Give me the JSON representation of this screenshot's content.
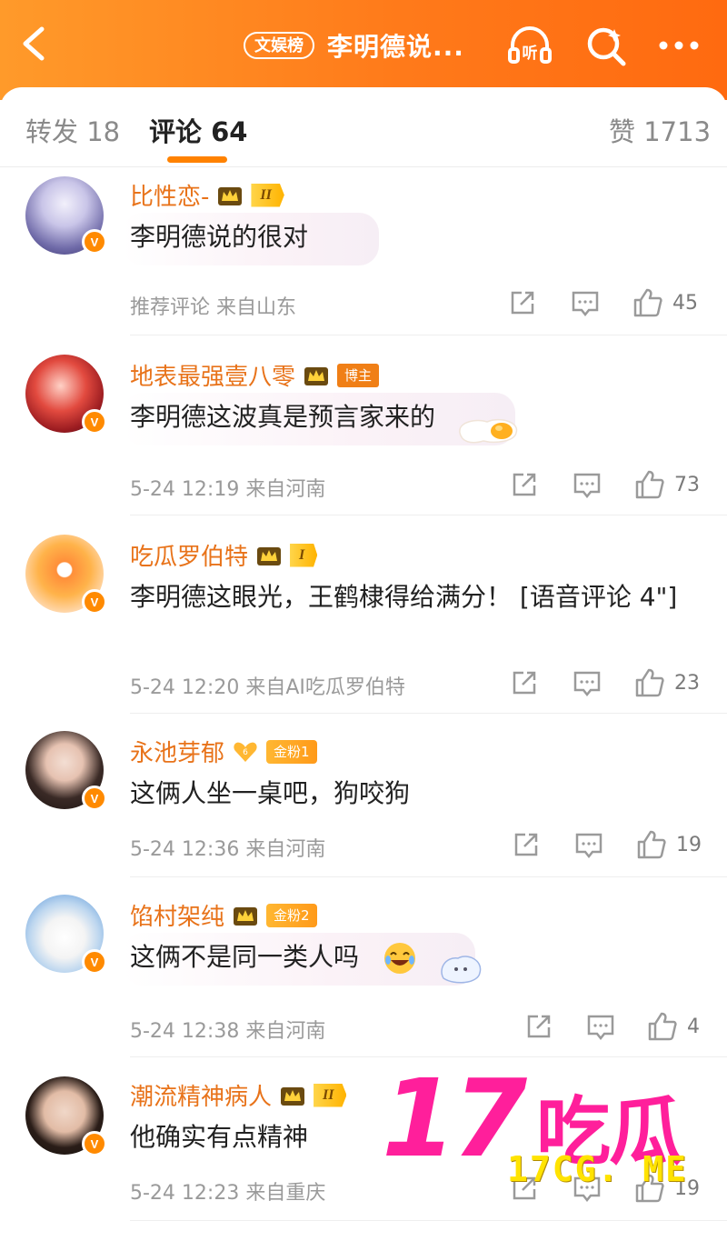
{
  "header": {
    "tag": "文娱榜",
    "title": "李明德说...",
    "listen_icon_text": "听"
  },
  "tabs": {
    "repost": "转发 18",
    "comments": "评论 64",
    "likes": "赞 1713"
  },
  "comments": [
    {
      "name": "比性恋-",
      "badge": "II",
      "text": "李明德说的很对",
      "meta": "推荐评论  来自山东",
      "likes": "45"
    },
    {
      "name": "地表最强壹八零",
      "badge": "博主",
      "text": "李明德这波真是预言家来的",
      "meta": "5-24 12:19  来自河南",
      "likes": "73"
    },
    {
      "name": "吃瓜罗伯特",
      "badge": "I",
      "text": "李明德这眼光，王鹤棣得给满分！ [语音评论 4\"]",
      "meta": "5-24 12:20  来自AI吃瓜罗伯特",
      "likes": "23"
    },
    {
      "name": "永池芽郁",
      "badge": "金粉1",
      "text": "这俩人坐一桌吧，狗咬狗",
      "meta": "5-24 12:36  来自河南",
      "likes": "19"
    },
    {
      "name": "馅村架纯",
      "badge": "金粉2",
      "text": "这俩不是同一类人吗",
      "meta": "5-24 12:38  来自河南",
      "likes": "4"
    },
    {
      "name": "潮流精神病人",
      "badge": "II",
      "text": "他确实有点精神",
      "meta": "5-24 12:23  来自重庆",
      "likes": "19"
    }
  ],
  "watermark": {
    "number": "17",
    "chinese": "吃瓜",
    "url": "17CG. ME"
  },
  "colors": {
    "brand_orange": "#ff7a1a",
    "username": "#e8731a",
    "watermark_pink": "#ff1f9b",
    "watermark_yellow": "#ffe300"
  }
}
